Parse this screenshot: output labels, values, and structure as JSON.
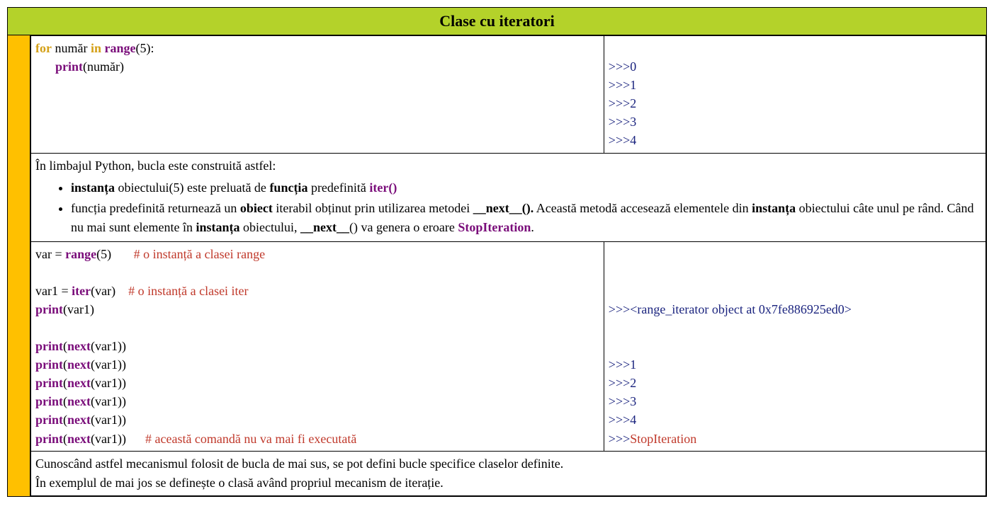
{
  "header": {
    "title": "Clase cu iteratori"
  },
  "row1": {
    "code": {
      "for": "for",
      "var": " număr ",
      "in": "in",
      "range": "range",
      "args": "(5):",
      "print": "print",
      "pargs": "(număr)"
    },
    "output": {
      "l0p": ">>>",
      "l0v": "0",
      "l1p": ">>>",
      "l1v": "1",
      "l2p": ">>>",
      "l2v": "2",
      "l3p": ">>>",
      "l3v": "3",
      "l4p": ">>>",
      "l4v": "4"
    }
  },
  "text1": {
    "intro": "În limbajul Python, bucla este construită astfel:",
    "b1a": "instanța",
    "b1b": " obiectului(5) este preluată de ",
    "b1c": "funcția",
    "b1d": " predefinită ",
    "b1e": "iter()",
    "b2a": "funcția predefinită returnează un ",
    "b2b": "obiect",
    "b2c": " iterabil obținut prin utilizarea metodei  ",
    "b2d": "__next__().",
    "b2e": " Această metodă accesează elementele din ",
    "b2f": "instanța",
    "b2g": " obiectului câte unul pe rând. Când nu mai sunt elemente în ",
    "b2h": "instanța",
    "b2i": " obiectului, ",
    "b2j": "__next__",
    "b2k": "() va genera o eroare ",
    "b2l": "StopIteration",
    "b2m": "."
  },
  "row2": {
    "code": {
      "l1a": "var = ",
      "l1b": "range",
      "l1c": "(5)",
      "l1d": "# o instanță a clasei range",
      "l2a": "var1 = ",
      "l2b": "iter",
      "l2c": "(var)",
      "l2d": "# o instanță a clasei iter",
      "l3a": "print",
      "l3b": "(var1)",
      "pn": "print",
      "na": "(",
      "nb": "next",
      "nc": "(var1))",
      "lcom": "# această comandă nu va mai fi executată"
    },
    "output": {
      "p": ">>>",
      "obj": "<range_iterator object at 0x7fe886925ed0>",
      "v1": "1",
      "v2": "2",
      "v3": "3",
      "v4": "4",
      "stop": "StopIteration"
    }
  },
  "text2": {
    "l1": "Cunoscând astfel mecanismul folosit de bucla de mai sus, se pot defini bucle specifice claselor definite.",
    "l2": "În exemplul de mai jos se definește o clasă având propriul mecanism de iterație."
  }
}
